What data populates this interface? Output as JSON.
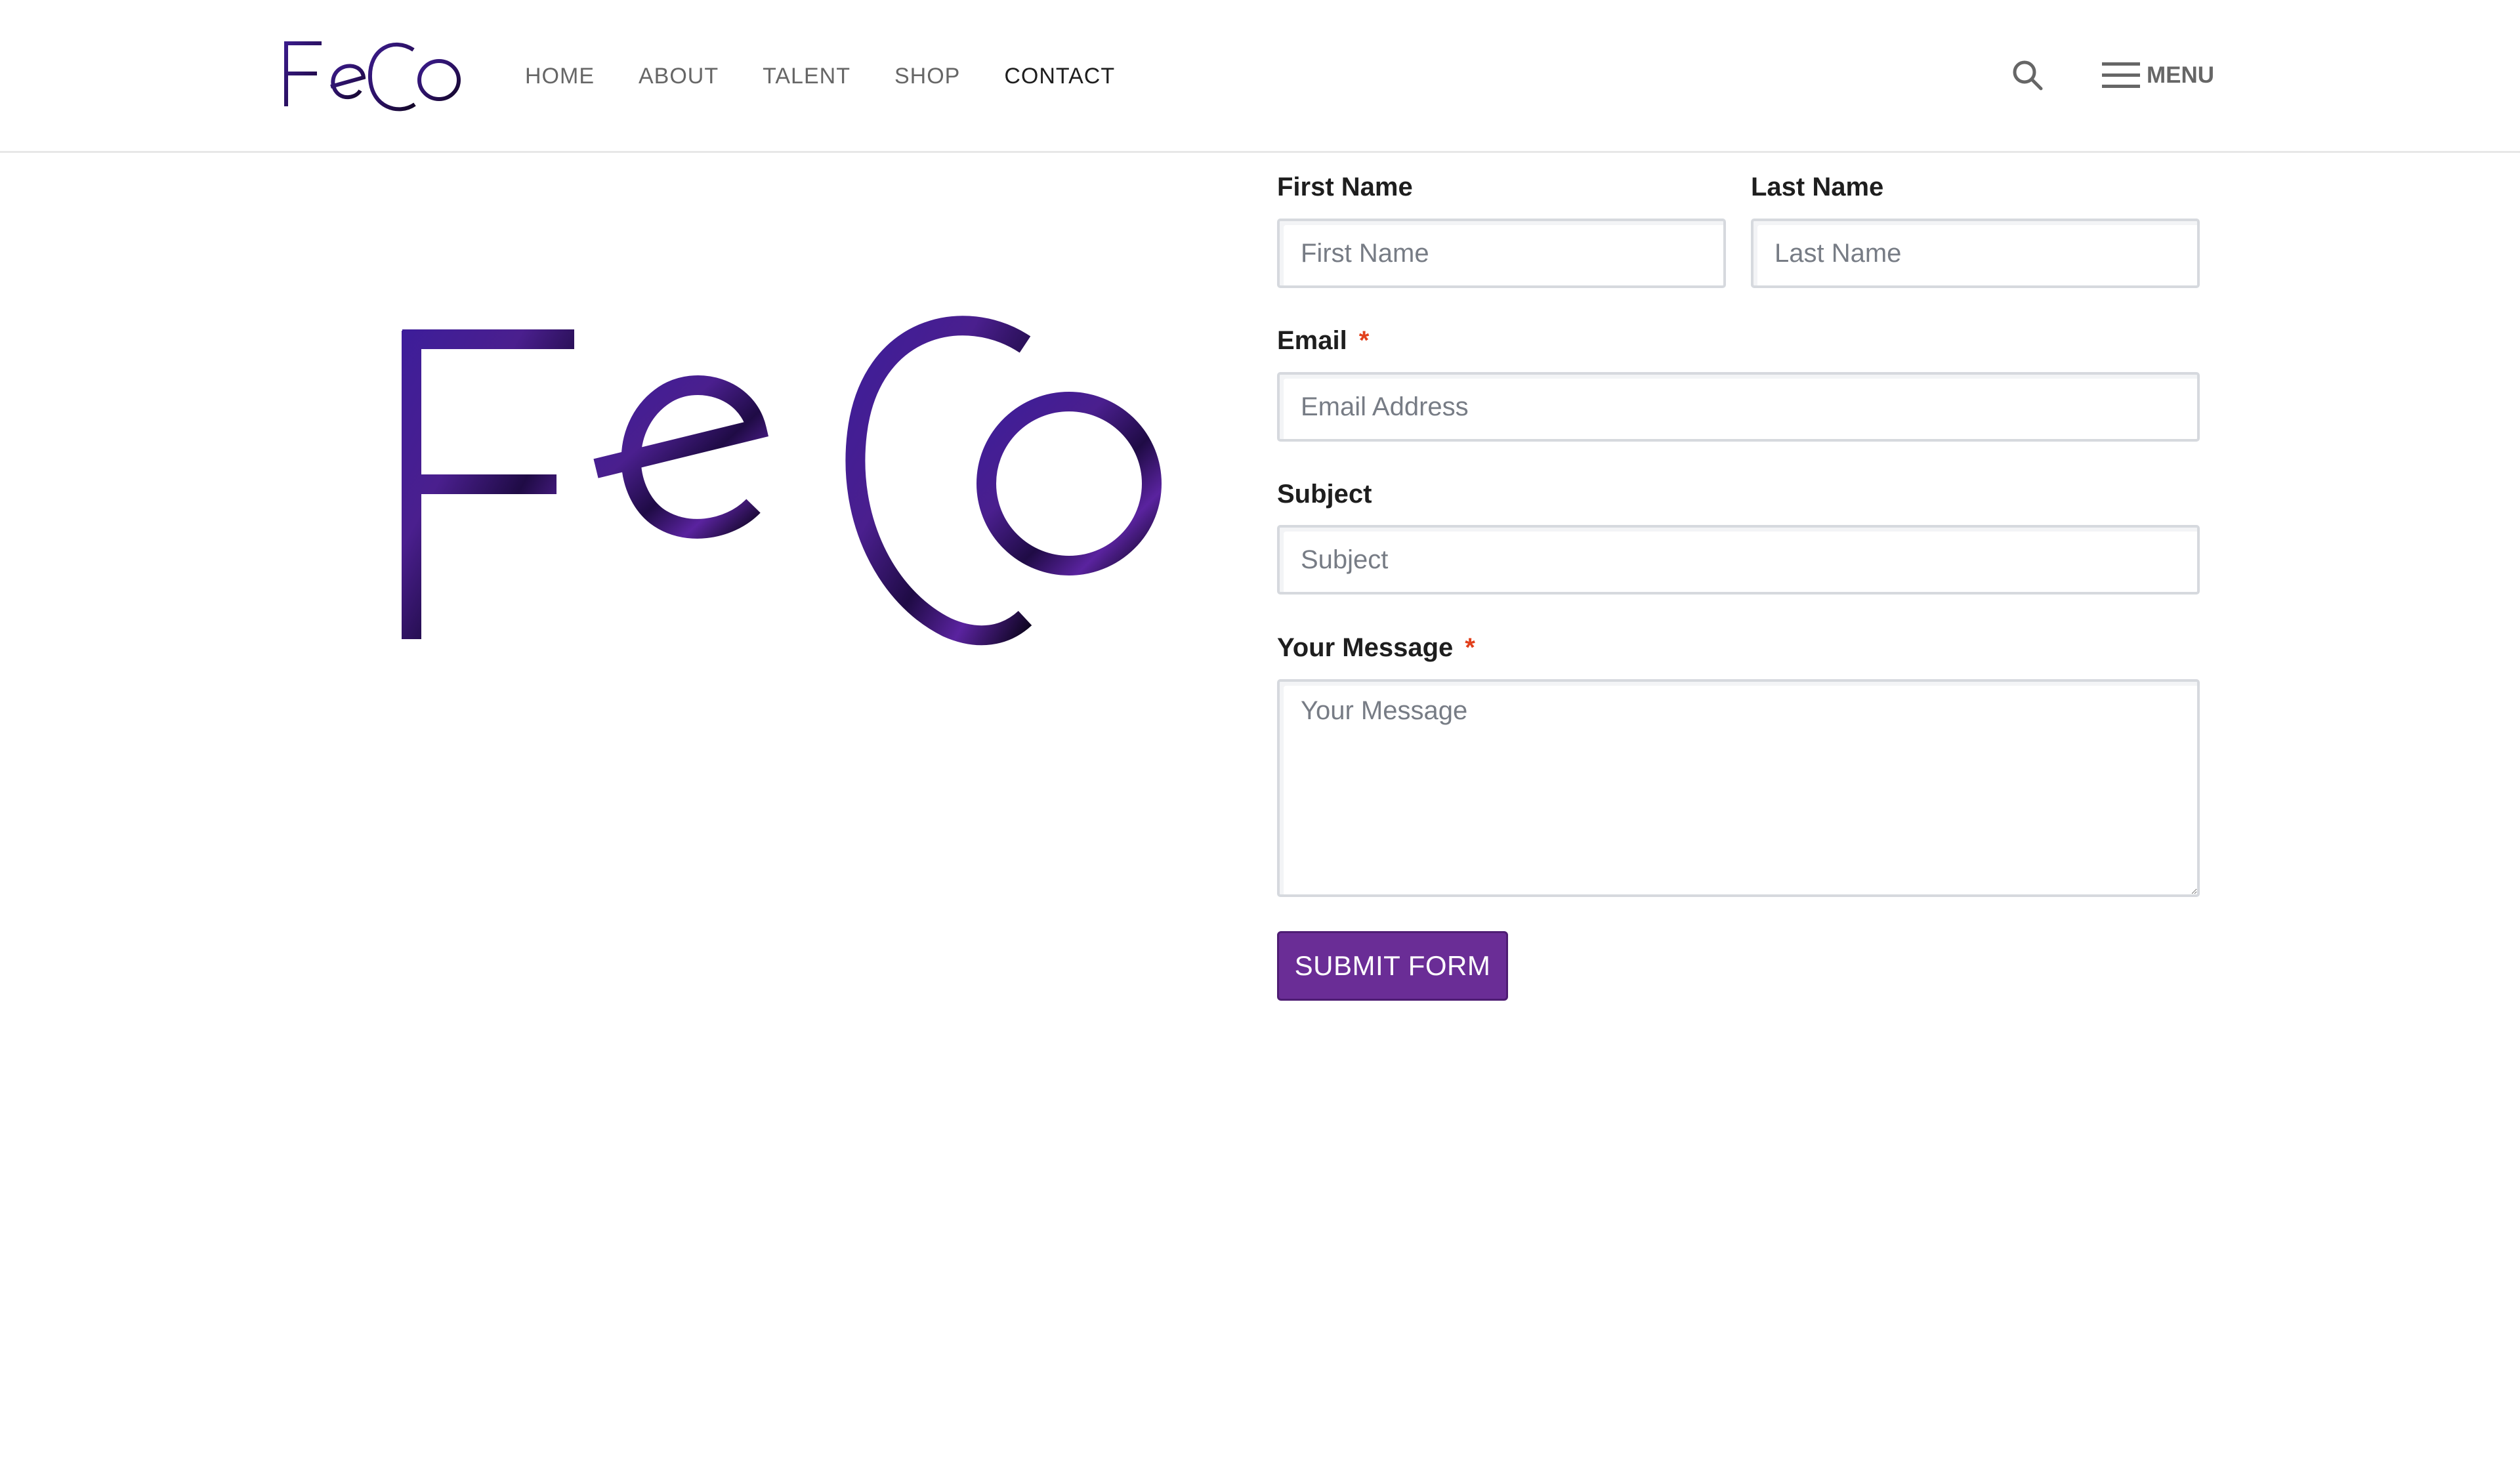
{
  "brand": {
    "name": "FeCo",
    "colors": {
      "primary": "#6a2d96",
      "logo_dark": "#1a0a3a",
      "logo_purple": "#3d1a8a"
    }
  },
  "nav": {
    "items": [
      {
        "label": "HOME",
        "active": false
      },
      {
        "label": "ABOUT",
        "active": false
      },
      {
        "label": "TALENT",
        "active": false
      },
      {
        "label": "SHOP",
        "active": false
      },
      {
        "label": "CONTACT",
        "active": true
      }
    ]
  },
  "header": {
    "search_icon": "search-icon",
    "menu_icon": "hamburger-icon",
    "menu_label": "MENU"
  },
  "form": {
    "first_name": {
      "label": "First Name",
      "placeholder": "First Name",
      "value": ""
    },
    "last_name": {
      "label": "Last Name",
      "placeholder": "Last Name",
      "value": ""
    },
    "email": {
      "label": "Email",
      "required_marker": "*",
      "placeholder": "Email Address",
      "value": ""
    },
    "subject": {
      "label": "Subject",
      "placeholder": "Subject",
      "value": ""
    },
    "message": {
      "label": "Your Message",
      "required_marker": "*",
      "placeholder": "Your Message",
      "value": ""
    },
    "submit_label": "SUBMIT FORM"
  }
}
